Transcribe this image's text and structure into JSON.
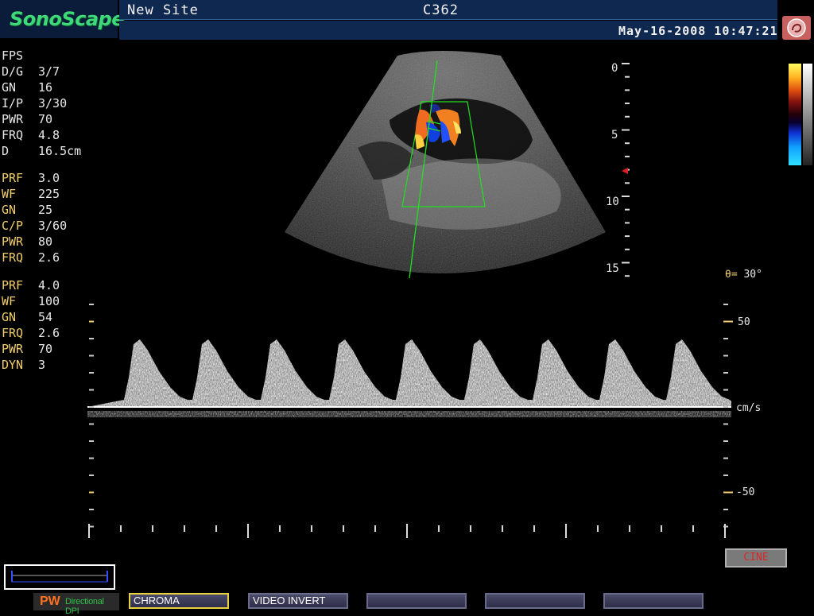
{
  "header": {
    "logo": "SonoScape",
    "site": "New Site",
    "probe": "C362",
    "datetime": "May-16-2008 10:47:21"
  },
  "params_b": [
    {
      "k": "FPS",
      "v": ""
    },
    {
      "k": "D/G",
      "v": "3/7"
    },
    {
      "k": "GN",
      "v": "16"
    },
    {
      "k": "I/P",
      "v": "3/30"
    },
    {
      "k": "PWR",
      "v": "70"
    },
    {
      "k": "FRQ",
      "v": "4.8"
    },
    {
      "k": "D",
      "v": "16.5cm"
    }
  ],
  "params_color": [
    {
      "k": "PRF",
      "v": "3.0"
    },
    {
      "k": "WF",
      "v": "225"
    },
    {
      "k": "GN",
      "v": "25"
    },
    {
      "k": "C/P",
      "v": "3/60"
    },
    {
      "k": "PWR",
      "v": "80"
    },
    {
      "k": "FRQ",
      "v": "2.6"
    }
  ],
  "params_pw": [
    {
      "k": "PRF",
      "v": "4.0"
    },
    {
      "k": "WF",
      "v": "100"
    },
    {
      "k": "GN",
      "v": "54"
    },
    {
      "k": "FRQ",
      "v": "2.6"
    },
    {
      "k": "PWR",
      "v": "70"
    },
    {
      "k": "DYN",
      "v": "3"
    }
  ],
  "depth_scale": [
    "0",
    "5",
    "10",
    "15"
  ],
  "angle": {
    "symbol": "θ=",
    "value": "30°"
  },
  "velocity_scale": {
    "top": "50",
    "baseline": "cm/s",
    "bottom": "-50"
  },
  "buttons": {
    "mode": "PW",
    "mode_sub": "Directional DPI",
    "softkeys": [
      "CHROMA",
      "VIDEO INVERT",
      "",
      "",
      ""
    ],
    "cine": "CINE"
  },
  "colors": {
    "accent_yellow": "#f2d06b",
    "header_bg": "#0f2850",
    "logo_green": "#3fd97a"
  }
}
